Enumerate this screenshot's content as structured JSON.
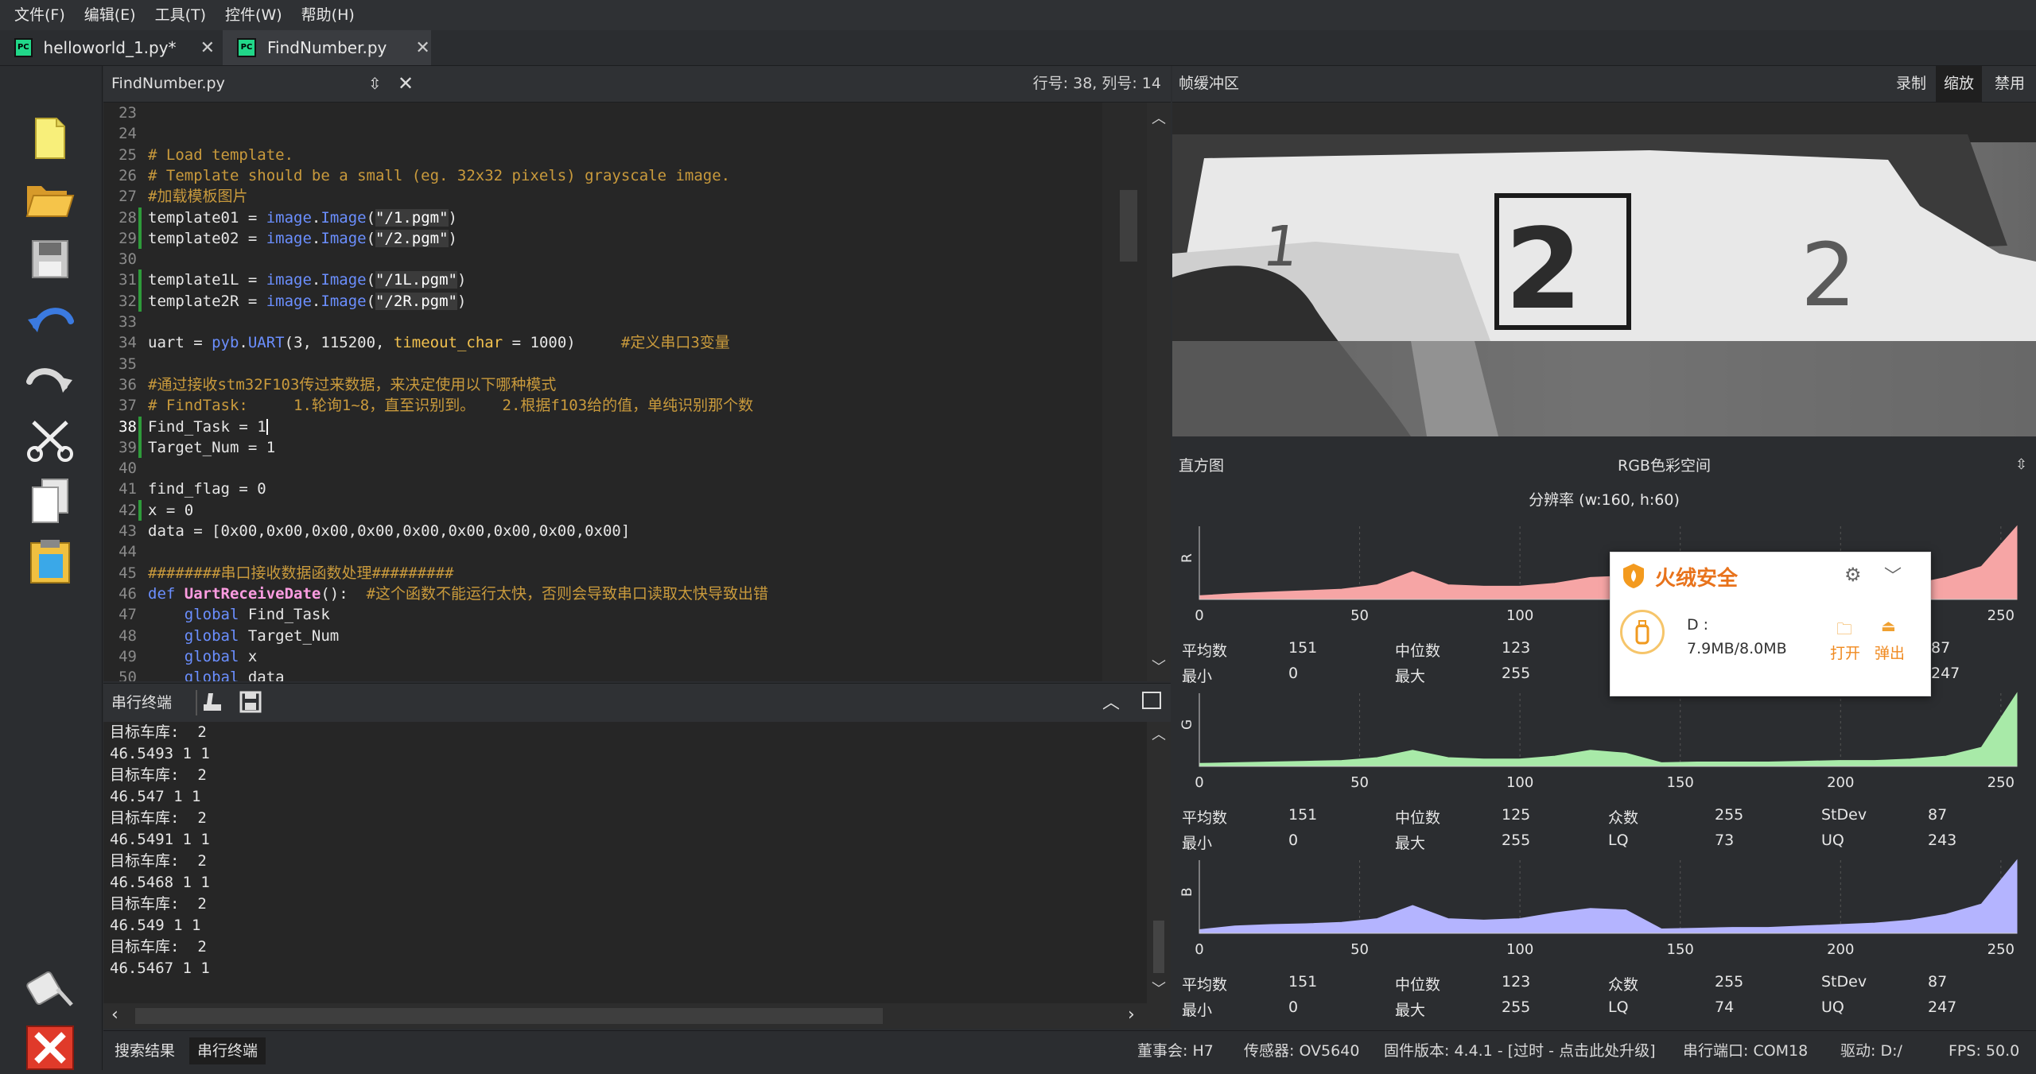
{
  "menu": [
    "文件(F)",
    "编辑(E)",
    "工具(T)",
    "控件(W)",
    "帮助(H)"
  ],
  "tabs": [
    {
      "label": "helloworld_1.py*",
      "close": "✕"
    },
    {
      "label": "FindNumber.py",
      "close": "✕"
    }
  ],
  "toolbar_icons": [
    "new-file-icon",
    "open-folder-icon",
    "save-icon",
    "undo-icon",
    "redo-icon",
    "cut-icon",
    "copy-icon",
    "paste-icon",
    "connect-icon",
    "stop-icon"
  ],
  "editor": {
    "filename": "FindNumber.py",
    "cursor_pos": "行号: 38, 列号: 14",
    "lines": [
      {
        "n": "23",
        "segs": []
      },
      {
        "n": "24",
        "segs": []
      },
      {
        "n": "25",
        "segs": [
          {
            "c": "cmt",
            "t": "# Load template."
          }
        ]
      },
      {
        "n": "26",
        "segs": [
          {
            "c": "cmt",
            "t": "# Template should be a small (eg. 32x32 pixels) grayscale image."
          }
        ]
      },
      {
        "n": "27",
        "segs": [
          {
            "c": "cmt",
            "t": "#加载模板图片"
          }
        ]
      },
      {
        "n": "28",
        "segs": [
          {
            "c": "txt",
            "t": "template01 = "
          },
          {
            "c": "kw",
            "t": "image"
          },
          {
            "c": "txt",
            "t": "."
          },
          {
            "c": "kw",
            "t": "Image"
          },
          {
            "c": "txt",
            "t": "("
          },
          {
            "c": "str",
            "t": "\"/1.pgm\""
          },
          {
            "c": "txt",
            "t": ")"
          }
        ]
      },
      {
        "n": "29",
        "segs": [
          {
            "c": "txt",
            "t": "template02 = "
          },
          {
            "c": "kw",
            "t": "image"
          },
          {
            "c": "txt",
            "t": "."
          },
          {
            "c": "kw",
            "t": "Image"
          },
          {
            "c": "txt",
            "t": "("
          },
          {
            "c": "str",
            "t": "\"/2.pgm\""
          },
          {
            "c": "txt",
            "t": ")"
          }
        ]
      },
      {
        "n": "30",
        "segs": []
      },
      {
        "n": "31",
        "segs": [
          {
            "c": "txt",
            "t": "template1L = "
          },
          {
            "c": "kw",
            "t": "image"
          },
          {
            "c": "txt",
            "t": "."
          },
          {
            "c": "kw",
            "t": "Image"
          },
          {
            "c": "txt",
            "t": "("
          },
          {
            "c": "str",
            "t": "\"/1L.pgm\""
          },
          {
            "c": "txt",
            "t": ")"
          }
        ]
      },
      {
        "n": "32",
        "segs": [
          {
            "c": "txt",
            "t": "template2R = "
          },
          {
            "c": "kw",
            "t": "image"
          },
          {
            "c": "txt",
            "t": "."
          },
          {
            "c": "kw",
            "t": "Image"
          },
          {
            "c": "txt",
            "t": "("
          },
          {
            "c": "str",
            "t": "\"/2R.pgm\""
          },
          {
            "c": "txt",
            "t": ")"
          }
        ]
      },
      {
        "n": "33",
        "segs": []
      },
      {
        "n": "34",
        "segs": [
          {
            "c": "txt",
            "t": "uart = "
          },
          {
            "c": "kw",
            "t": "pyb"
          },
          {
            "c": "txt",
            "t": "."
          },
          {
            "c": "kw",
            "t": "UART"
          },
          {
            "c": "txt",
            "t": "(3, 115200, "
          },
          {
            "c": "par",
            "t": "timeout_char"
          },
          {
            "c": "txt",
            "t": " = 1000)     "
          },
          {
            "c": "cmt",
            "t": "#定义串口3变量"
          }
        ]
      },
      {
        "n": "35",
        "segs": []
      },
      {
        "n": "36",
        "segs": [
          {
            "c": "cmt",
            "t": "#通过接收stm32F103传过来数据，来决定使用以下哪种模式"
          }
        ]
      },
      {
        "n": "37",
        "segs": [
          {
            "c": "cmt",
            "t": "# FindTask:     1.轮询1~8，直至识别到。   2.根据f103给的值，单纯识别那个数"
          }
        ]
      },
      {
        "n": "38",
        "cur": true,
        "segs": [
          {
            "c": "txt",
            "t": "Find_Task = 1"
          }
        ]
      },
      {
        "n": "39",
        "segs": [
          {
            "c": "txt",
            "t": "Target_Num = 1"
          }
        ]
      },
      {
        "n": "40",
        "segs": []
      },
      {
        "n": "41",
        "segs": [
          {
            "c": "txt",
            "t": "find_flag = 0"
          }
        ]
      },
      {
        "n": "42",
        "segs": [
          {
            "c": "txt",
            "t": "x = 0"
          }
        ]
      },
      {
        "n": "43",
        "segs": [
          {
            "c": "txt",
            "t": "data = [0x00,0x00,0x00,0x00,0x00,0x00,0x00,0x00,0x00]"
          }
        ]
      },
      {
        "n": "44",
        "segs": []
      },
      {
        "n": "45",
        "segs": [
          {
            "c": "cmt",
            "t": "########串口接收数据函数处理#########"
          }
        ]
      },
      {
        "n": "46",
        "segs": [
          {
            "c": "kw",
            "t": "def "
          },
          {
            "c": "fnm",
            "t": "UartReceiveDate"
          },
          {
            "c": "txt",
            "t": "():  "
          },
          {
            "c": "cmt",
            "t": "#这个函数不能运行太快，否则会导致串口读取太快导致出错"
          }
        ]
      },
      {
        "n": "47",
        "segs": [
          {
            "c": "txt",
            "t": "    "
          },
          {
            "c": "kw",
            "t": "global"
          },
          {
            "c": "txt",
            "t": " Find_Task"
          }
        ]
      },
      {
        "n": "48",
        "segs": [
          {
            "c": "txt",
            "t": "    "
          },
          {
            "c": "kw",
            "t": "global"
          },
          {
            "c": "txt",
            "t": " Target_Num"
          }
        ]
      },
      {
        "n": "49",
        "segs": [
          {
            "c": "txt",
            "t": "    "
          },
          {
            "c": "kw",
            "t": "global"
          },
          {
            "c": "txt",
            "t": " x"
          }
        ]
      },
      {
        "n": "50",
        "segs": [
          {
            "c": "txt",
            "t": "    "
          },
          {
            "c": "kw",
            "t": "global"
          },
          {
            "c": "txt",
            "t": " data"
          }
        ]
      }
    ]
  },
  "terminal": {
    "title": "串行终端",
    "lines": [
      "目标车库:  2",
      "46.5493 1 1",
      "目标车库:  2",
      "46.547 1 1",
      "目标车库:  2",
      "46.5491 1 1",
      "目标车库:  2",
      "46.5468 1 1",
      "目标车库:  2",
      "46.549 1 1",
      "目标车库:  2",
      "46.5467 1 1"
    ]
  },
  "bottom_tabs": [
    "搜索结果",
    "串行终端"
  ],
  "status": {
    "board": "董事会: H7",
    "sensor": "传感器: OV5640",
    "firmware": "固件版本: 4.4.1 - [过时 - 点击此处升级]",
    "port": "串行端口: COM18",
    "drive": "驱动: D:/",
    "fps": "FPS:  50.0"
  },
  "framebuffer": {
    "title": "帧缓冲区",
    "buttons": [
      "录制",
      "缩放",
      "禁用"
    ],
    "active_button": "缩放"
  },
  "histogram": {
    "title": "直方图",
    "colorspace": "RGB色彩空间",
    "resolution": "分辨率 (w:160, h:60)",
    "channels": [
      {
        "label": "R",
        "color": "#f6a5a5",
        "values": [
          0.05,
          0.08,
          0.1,
          0.12,
          0.14,
          0.2,
          0.38,
          0.2,
          0.18,
          0.18,
          0.22,
          0.3,
          0.32,
          0.1,
          0.12,
          0.14,
          0.12,
          0.14,
          0.16,
          0.18,
          0.2,
          0.3,
          0.45,
          1.0
        ],
        "stats": {
          "mean_label": "平均数",
          "mean": "151",
          "median_label": "中位数",
          "median": "123",
          "min_label": "最小",
          "min": "0",
          "max_label": "最大",
          "max": "255",
          "uq_tail": "247",
          "std_tail": "87"
        }
      },
      {
        "label": "G",
        "color": "#a8eaa8",
        "values": [
          0.04,
          0.05,
          0.06,
          0.07,
          0.08,
          0.12,
          0.22,
          0.12,
          0.1,
          0.1,
          0.14,
          0.22,
          0.18,
          0.05,
          0.06,
          0.06,
          0.06,
          0.07,
          0.08,
          0.08,
          0.1,
          0.14,
          0.26,
          1.0
        ],
        "stats": {
          "mean_label": "平均数",
          "mean": "151",
          "median_label": "中位数",
          "median": "125",
          "mode_label": "众数",
          "mode": "255",
          "stdev_label": "StDev",
          "stdev": "87",
          "min_label": "最小",
          "min": "0",
          "max_label": "最大",
          "max": "255",
          "lq_label": "LQ",
          "lq": "73",
          "uq_label": "UQ",
          "uq": "243"
        }
      },
      {
        "label": "B",
        "color": "#b4b4ff",
        "values": [
          0.05,
          0.1,
          0.12,
          0.13,
          0.15,
          0.2,
          0.38,
          0.2,
          0.18,
          0.2,
          0.28,
          0.34,
          0.32,
          0.06,
          0.07,
          0.08,
          0.08,
          0.1,
          0.12,
          0.14,
          0.18,
          0.26,
          0.4,
          1.0
        ],
        "stats": {
          "mean_label": "平均数",
          "mean": "151",
          "median_label": "中位数",
          "median": "123",
          "mode_label": "众数",
          "mode": "255",
          "stdev_label": "StDev",
          "stdev": "87",
          "min_label": "最小",
          "min": "0",
          "max_label": "最大",
          "max": "255",
          "lq_label": "LQ",
          "lq": "74",
          "uq_label": "UQ",
          "uq": "247"
        }
      }
    ],
    "x_ticks": [
      "0",
      "50",
      "100",
      "150",
      "200",
      "250"
    ]
  },
  "popup": {
    "brand": "火绒安全",
    "drive_label": "D :",
    "usage": "7.9MB/8.0MB",
    "open": "打开",
    "eject": "弹出"
  }
}
